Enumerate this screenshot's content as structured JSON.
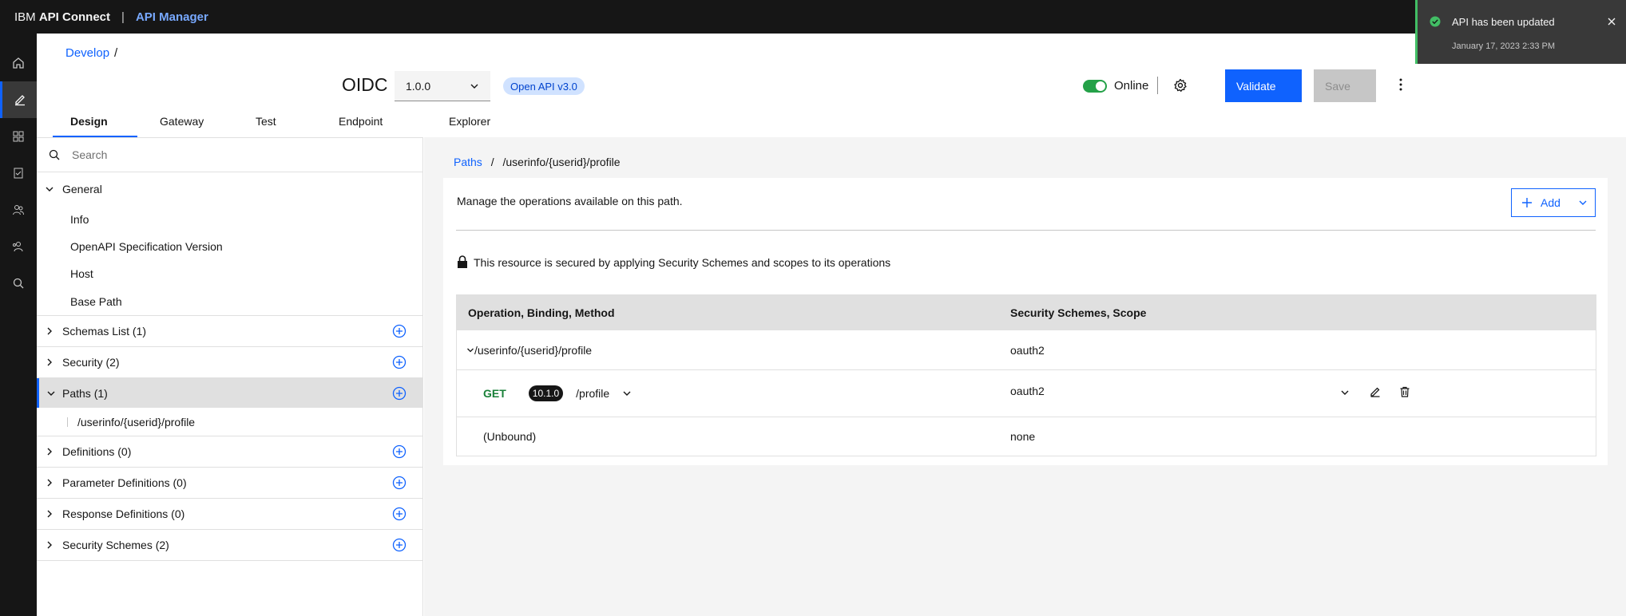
{
  "topbar": {
    "brand_prefix": "IBM ",
    "brand_bold": "API Connect",
    "separator": "|",
    "product": "API Manager"
  },
  "rail": [
    "home-icon",
    "edit-icon",
    "apps-icon",
    "document-icon",
    "users-icon",
    "community-icon",
    "search-icon"
  ],
  "breadcrumb": {
    "develop": "Develop",
    "slash": "/"
  },
  "api": {
    "title": "OIDC",
    "version": "1.0.0",
    "spec_badge": "Open API v3.0"
  },
  "header": {
    "online_label": "Online",
    "validate_label": "Validate",
    "save_label": "Save"
  },
  "tabs": [
    "Design",
    "Gateway",
    "Test",
    "Endpoint",
    "Explorer"
  ],
  "sidebar": {
    "search_placeholder": "Search",
    "general": {
      "label": "General",
      "items": [
        "Info",
        "OpenAPI Specification Version",
        "Host",
        "Base Path"
      ]
    },
    "schemas": "Schemas List (1)",
    "security": "Security (2)",
    "paths": "Paths (1)",
    "paths_item": "/userinfo/{userid}/profile",
    "definitions": "Definitions (0)",
    "parameter_definitions": "Parameter Definitions (0)",
    "response_definitions": "Response Definitions (0)",
    "security_schemes": "Security Schemes (2)"
  },
  "main": {
    "breadcrumb_link": "Paths",
    "breadcrumb_slash": "/",
    "breadcrumb_current": "/userinfo/{userid}/profile",
    "description": "Manage the operations available on this path.",
    "add_label": "Add",
    "secured_message": "This resource is secured by applying Security Schemes and scopes to its operations",
    "table": {
      "headers": [
        "Operation, Binding, Method",
        "Security Schemes, Scope"
      ],
      "path_row": {
        "path": "/userinfo/{userid}/profile",
        "scope": "oauth2"
      },
      "op_row": {
        "method": "GET",
        "version": "10.1.0",
        "path": "/profile",
        "scope": "oauth2"
      },
      "unbound_row": {
        "label": "(Unbound)",
        "scope": "none"
      }
    }
  },
  "toast": {
    "title": "API has been updated",
    "timestamp": "January 17, 2023 2:33 PM"
  },
  "colors": {
    "primary": "#0f62fe",
    "success": "#24a148",
    "topbar": "#161616"
  }
}
